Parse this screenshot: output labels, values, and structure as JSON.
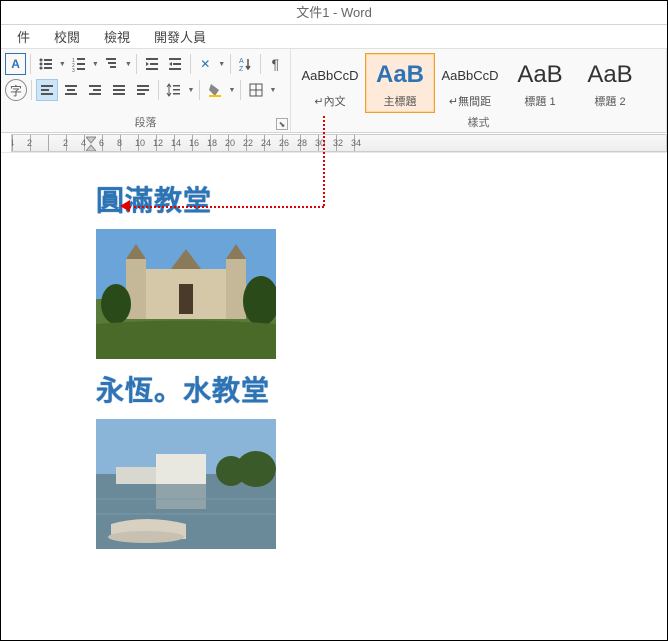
{
  "title": "文件1 - Word",
  "menu": {
    "file": "件",
    "review": "校閱",
    "view": "檢視",
    "dev": "開發人員"
  },
  "ribbon": {
    "paragraph_label": "段落",
    "styles_label": "樣式"
  },
  "styles": [
    {
      "preview": "AaBbCcD",
      "label": "↵內文",
      "size": "13px",
      "color": "#333",
      "weight": "normal"
    },
    {
      "preview": "AaB",
      "label": "主標題",
      "size": "24px",
      "color": "#2e74b5",
      "weight": "bold"
    },
    {
      "preview": "AaBbCcD",
      "label": "↵無間距",
      "size": "13px",
      "color": "#333",
      "weight": "normal"
    },
    {
      "preview": "AaB",
      "label": "標題 1",
      "size": "24px",
      "color": "#333",
      "weight": "normal"
    },
    {
      "preview": "AaB",
      "label": "標題 2",
      "size": "24px",
      "color": "#333",
      "weight": "normal"
    }
  ],
  "ruler": [
    "4",
    "2",
    " ",
    "2",
    "4",
    "6",
    "8",
    "10",
    "12",
    "14",
    "16",
    "18",
    "20",
    "22",
    "24",
    "26",
    "28",
    "30",
    "32",
    "34"
  ],
  "doc": {
    "heading1": "圓滿教堂",
    "heading2": "永恆。水教堂"
  }
}
